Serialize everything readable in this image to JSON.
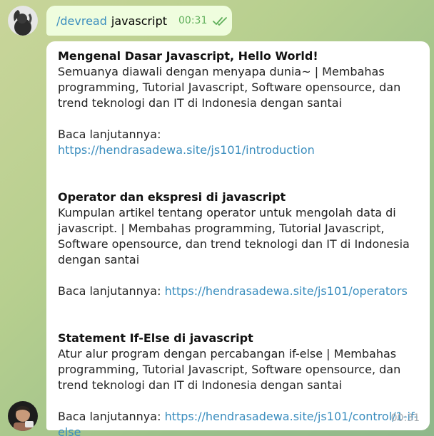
{
  "outgoing": {
    "command": "/devread",
    "argument": "javascript",
    "time": "00:31"
  },
  "incoming": {
    "time": "00:31",
    "read_more_label": "Baca lanjutannya:",
    "articles": [
      {
        "title": "Mengenal Dasar Javascript, Hello World!",
        "description": "Semuanya diawali dengan menyapa dunia~ | Membahas programming, Tutorial Javascript, Software opensource, dan trend teknologi dan IT di Indonesia dengan santai",
        "link": "https://hendrasadewa.site/js101/introduction"
      },
      {
        "title": "Operator dan ekspresi di javascript",
        "description": "Kumpulan artikel tentang operator untuk mengolah data di javascript. | Membahas programming, Tutorial Javascript, Software opensource, dan trend teknologi dan IT di Indonesia dengan santai",
        "link": "https://hendrasadewa.site/js101/operators"
      },
      {
        "title": "Statement If-Else di javascript",
        "description": "Atur alur program dengan percabangan if-else | Membahas programming, Tutorial Javascript, Software opensource, dan trend teknologi dan IT di Indonesia dengan santai",
        "link": "https://hendrasadewa.site/js101/control/1-if-else"
      }
    ]
  },
  "colors": {
    "outgoing_bubble": "#effdde",
    "incoming_bubble": "#ffffff",
    "link": "#3a8dbe",
    "read_check": "#5faf5a"
  },
  "icons": {
    "read_status": "double-check-icon"
  }
}
